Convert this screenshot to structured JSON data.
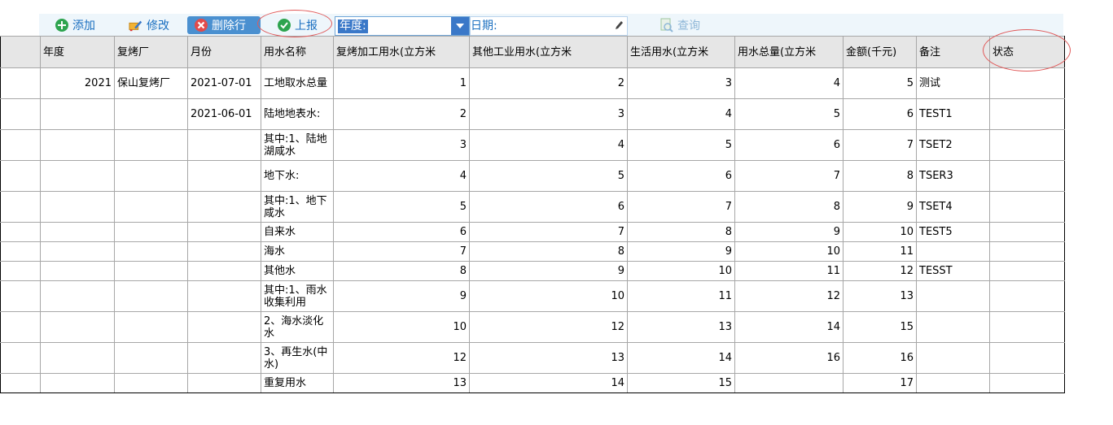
{
  "toolbar": {
    "add_label": "添加",
    "edit_label": "修改",
    "delete_label": "删除行",
    "report_label": "上报",
    "year_label": "年度:",
    "date_label": "日期:",
    "query_label": "查询"
  },
  "colors": {
    "accent": "#1a6fc0",
    "selected": "#3a78c8",
    "delete_bg": "#4a90d0",
    "highlight_circle": "#e05a5a"
  },
  "table": {
    "headers": [
      "年度",
      "复烤厂",
      "月份",
      "用水名称",
      "复烤加工用水(立方米",
      "其他工业用水(立方米",
      "生活用水(立方米",
      "用水总量(立方米",
      "金额(千元)",
      "备注",
      "状态"
    ],
    "rows": [
      [
        "2021",
        "保山复烤厂",
        "2021-07-01",
        "工地取水总量",
        "1",
        "2",
        "3",
        "4",
        "5",
        "测试",
        ""
      ],
      [
        "",
        "",
        "2021-06-01",
        "陆地地表水:",
        "2",
        "3",
        "4",
        "5",
        "6",
        "TEST1",
        ""
      ],
      [
        "",
        "",
        "",
        "其中:1、陆地湖咸水",
        "3",
        "4",
        "5",
        "6",
        "7",
        "TSET2",
        ""
      ],
      [
        "",
        "",
        "",
        "地下水:",
        "4",
        "5",
        "6",
        "7",
        "8",
        "TSER3",
        ""
      ],
      [
        "",
        "",
        "",
        "其中:1、地下咸水",
        "5",
        "6",
        "7",
        "8",
        "9",
        "TSET4",
        ""
      ],
      [
        "",
        "",
        "",
        "自来水",
        "6",
        "7",
        "8",
        "9",
        "10",
        "TEST5",
        ""
      ],
      [
        "",
        "",
        "",
        "海水",
        "7",
        "8",
        "9",
        "10",
        "11",
        "",
        ""
      ],
      [
        "",
        "",
        "",
        "其他水",
        "8",
        "9",
        "10",
        "11",
        "12",
        "TESST",
        ""
      ],
      [
        "",
        "",
        "",
        "其中:1、雨水收集利用",
        "9",
        "10",
        "11",
        "12",
        "13",
        "",
        ""
      ],
      [
        "",
        "",
        "",
        "2、海水淡化水",
        "10",
        "12",
        "13",
        "14",
        "15",
        "",
        ""
      ],
      [
        "",
        "",
        "",
        "3、再生水(中水)",
        "12",
        "13",
        "14",
        "16",
        "16",
        "",
        ""
      ],
      [
        "",
        "",
        "",
        "重复用水",
        "13",
        "14",
        "15",
        "",
        "17",
        "",
        ""
      ]
    ]
  }
}
